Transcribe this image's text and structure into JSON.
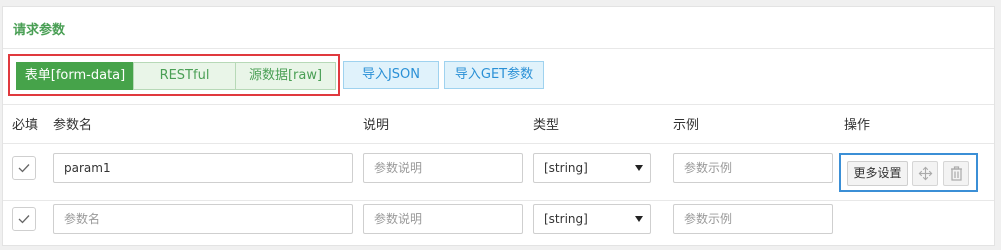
{
  "panel": {
    "title": "请求参数"
  },
  "modes": [
    {
      "label": "表单[form-data]",
      "active": true
    },
    {
      "label": "RESTful",
      "active": false
    },
    {
      "label": "源数据[raw]",
      "active": false
    }
  ],
  "actions": {
    "import_json": "导入JSON",
    "import_get": "导入GET参数"
  },
  "table": {
    "headers": {
      "required": "必填",
      "name": "参数名",
      "desc": "说明",
      "type": "类型",
      "example": "示例",
      "ops": "操作"
    },
    "rows": [
      {
        "required": true,
        "name_value": "param1",
        "name_placeholder": "参数名",
        "desc_value": "",
        "desc_placeholder": "参数说明",
        "type": "[string]",
        "example_value": "",
        "example_placeholder": "参数示例",
        "ops": {
          "more_label": "更多设置",
          "move_icon": "move-icon",
          "delete_icon": "trash-icon"
        }
      },
      {
        "required": true,
        "name_value": "",
        "name_placeholder": "参数名",
        "desc_value": "",
        "desc_placeholder": "参数说明",
        "type": "[string]",
        "example_value": "",
        "example_placeholder": "参数示例"
      }
    ]
  },
  "colors": {
    "green_title": "#4a9f55",
    "green_active": "#46a34a",
    "blue_text": "#2a90d6",
    "red_highlight": "#e0393e",
    "blue_highlight": "#3b8fd6"
  }
}
